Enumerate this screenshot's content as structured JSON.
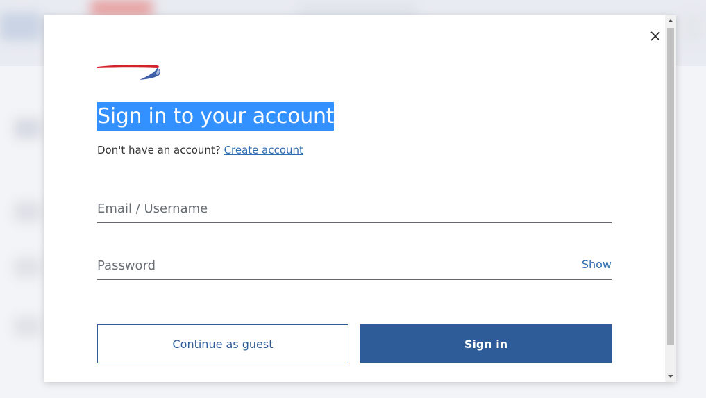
{
  "modal": {
    "heading": "Sign in to your account",
    "signup_prompt": "Don't have an account?",
    "create_account_link": "Create account",
    "email_placeholder": "Email / Username",
    "password_placeholder": "Password",
    "show_label": "Show",
    "guest_button": "Continue as guest",
    "signin_button": "Sign in"
  },
  "icons": {
    "close": "close-icon",
    "logo": "speedmarque-logo",
    "scroll_up": "scroll-up-arrow-icon",
    "scroll_down": "scroll-down-arrow-icon"
  },
  "colors": {
    "primary": "#2e5c99",
    "link": "#2f6db3",
    "selection": "#3390ff",
    "logo_red": "#d2232a",
    "logo_blue": "#3f5fa8"
  }
}
